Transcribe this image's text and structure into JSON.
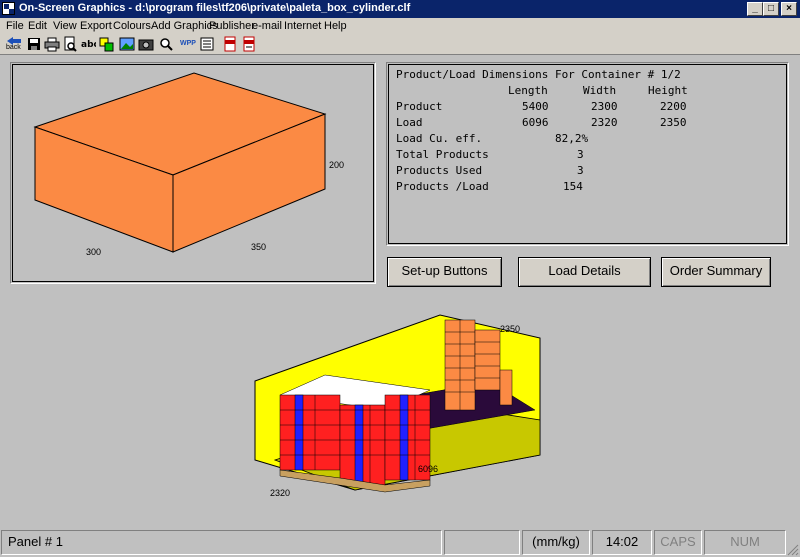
{
  "window": {
    "title": "On-Screen Graphics - d:\\program files\\tf206\\private\\paleta_box_cylinder.clf",
    "min_label": "_",
    "max_label": "□",
    "close_label": "×"
  },
  "menu": [
    "File",
    "Edit",
    "View",
    "Export",
    "Colours",
    "Add Graphics",
    "Publisher",
    "e-mail",
    "Internet",
    "Help"
  ],
  "toolbar": {
    "back_label": "back",
    "icons": [
      "save-icon",
      "print-icon",
      "print-preview-icon",
      "abc-icon",
      "shapes-icon",
      "image-icon",
      "camera-icon",
      "zoom-icon",
      "wpp-icon",
      "settings-icon",
      "pdf-icon",
      "pdf-export-icon"
    ],
    "wpp_label": "WPP"
  },
  "box_view": {
    "dim_length": "350",
    "dim_width": "300",
    "dim_height": "200",
    "box_color": "#fb8a44"
  },
  "info": {
    "title": "Product/Load Dimensions For Container # 1/2",
    "col_length": "Length",
    "col_width": "Width",
    "col_height": "Height",
    "product_label": "Product",
    "product_length": "5400",
    "product_width": "2300",
    "product_height": "2200",
    "load_label": "Load",
    "load_length": "6096",
    "load_width": "2320",
    "load_height": "2350",
    "cu_eff_label": "Load Cu. eff.",
    "cu_eff_value": "82,2%",
    "total_products_label": "Total Products",
    "total_products_value": "3",
    "products_used_label": "Products Used",
    "products_used_value": "3",
    "products_load_label": "Products /Load",
    "products_load_value": "154"
  },
  "buttons": {
    "setup": "Set-up Buttons",
    "load_details": "Load Details",
    "order_summary": "Order Summary"
  },
  "container_view": {
    "dim_length": "6096",
    "dim_width": "2320",
    "dim_height": "2350",
    "container_color": "#ffff00"
  },
  "status": {
    "panel": "Panel # 1",
    "units": "(mm/kg)",
    "time": "14:02",
    "caps": "CAPS",
    "num": "NUM"
  }
}
